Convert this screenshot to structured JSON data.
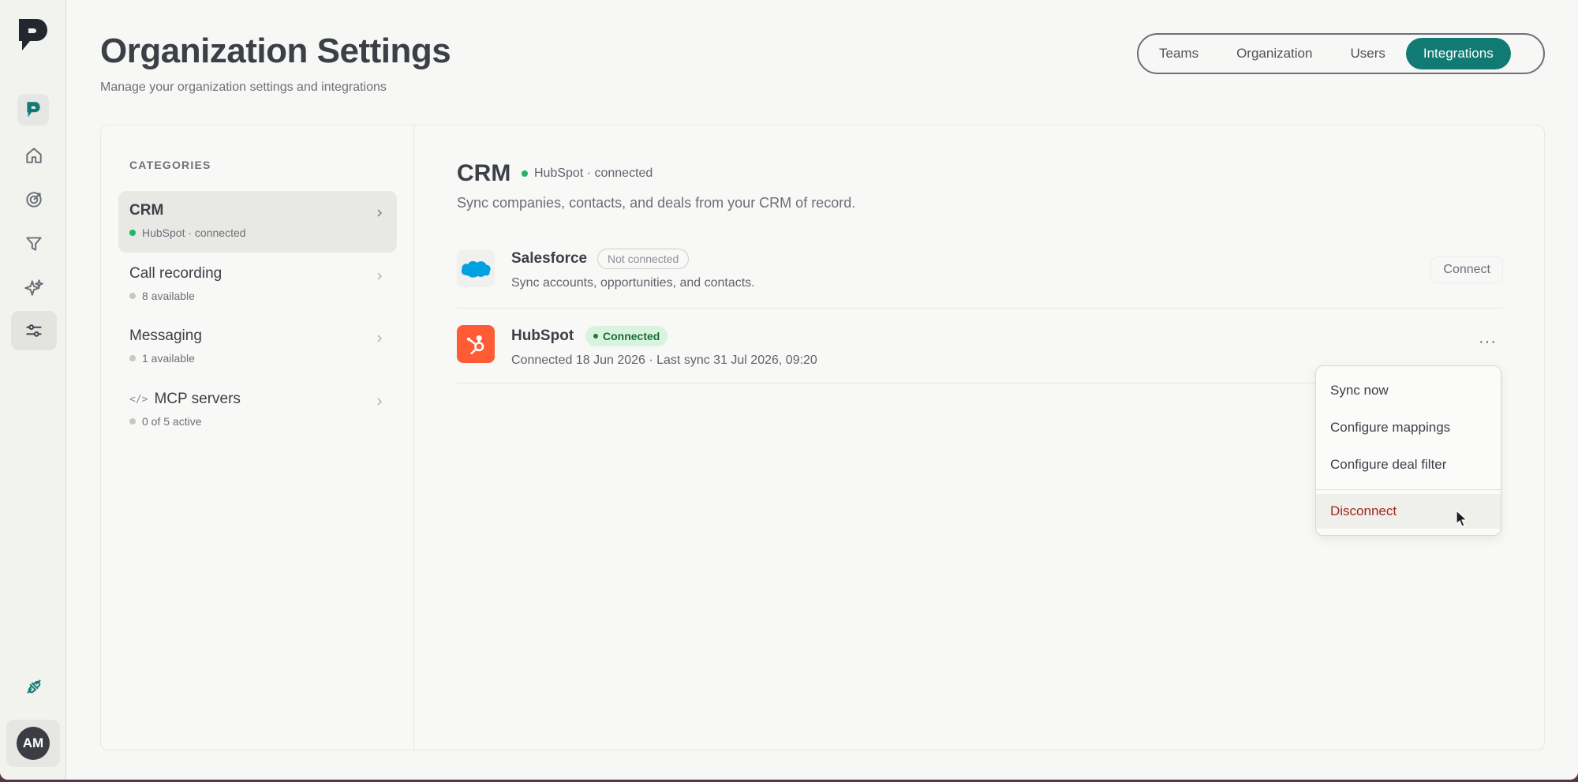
{
  "header": {
    "title": "Organization Settings",
    "subtitle": "Manage your organization settings and integrations"
  },
  "tabs": [
    {
      "label": "Teams",
      "active": false
    },
    {
      "label": "Organization",
      "active": false
    },
    {
      "label": "Users",
      "active": false
    },
    {
      "label": "Integrations",
      "active": true
    }
  ],
  "sidebar": {
    "avatar_initials": "AM",
    "icons": [
      "app-logo-icon",
      "home-icon",
      "target-icon",
      "filter-icon",
      "sparkle-icon",
      "sliders-icon",
      "plug-icon"
    ]
  },
  "categories": {
    "heading": "CATEGORIES",
    "items": [
      {
        "name": "CRM",
        "sub": "HubSpot · connected",
        "active": true,
        "status": "connected"
      },
      {
        "name": "Call recording",
        "sub": "8 available",
        "active": false,
        "status": "neutral"
      },
      {
        "name": "Messaging",
        "sub": "1 available",
        "active": false,
        "status": "neutral"
      },
      {
        "name": "MCP servers",
        "sub": "0 of 5 active",
        "active": false,
        "status": "neutral",
        "icon": "code-icon"
      }
    ]
  },
  "crm": {
    "title": "CRM",
    "status": "HubSpot · connected",
    "description": "Sync companies, contacts, and deals from your CRM of record."
  },
  "integrations": [
    {
      "name": "Salesforce",
      "badge": "Not connected",
      "description": "Sync accounts, opportunities, and contacts.",
      "action": "Connect"
    },
    {
      "name": "HubSpot",
      "badge": "Connected",
      "description": "Connected 18 Jun 2026 · Last sync 31 Jul 2026, 09:20",
      "action": "···"
    }
  ],
  "menu": {
    "items": [
      "Sync now",
      "Configure mappings",
      "Configure deal filter"
    ],
    "danger_item": "Disconnect"
  },
  "colors": {
    "accent": "#117a73",
    "connected_green": "#22b566",
    "danger": "#a4271d",
    "salesforce_blue": "#00a1e0",
    "hubspot_orange": "#ff5c35"
  }
}
